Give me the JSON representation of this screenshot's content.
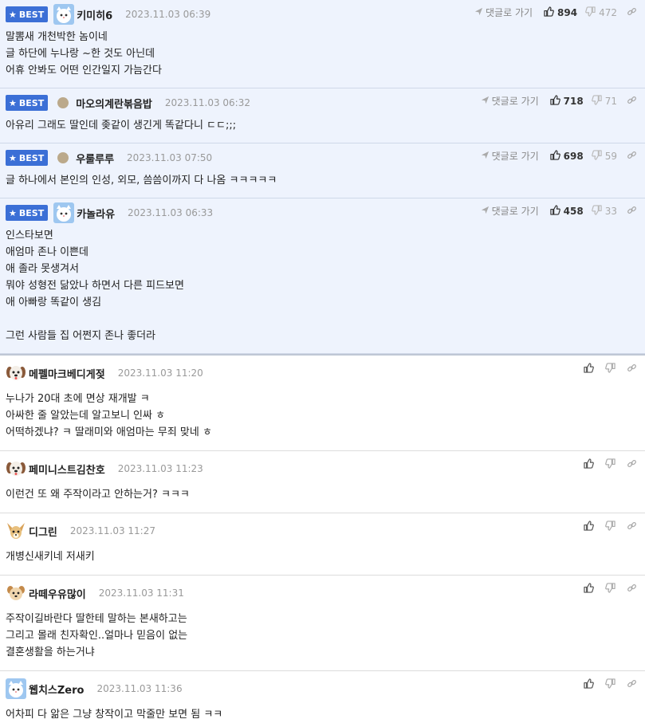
{
  "best_comments": [
    {
      "badge": "BEST",
      "avatar_icon": "white-cat-avatar-icon",
      "nick": "키미히6",
      "date": "2023.11.03 06:39",
      "goto": "댓글로 가기",
      "likes": "894",
      "dislikes": "472",
      "lines": [
        "말뽐새 개천박한 놈이네",
        "글 하단에 누나랑 ~한 것도 아닌데",
        "어휴 안봐도 어떤 인간일지 가늠간다"
      ]
    },
    {
      "badge": "BEST",
      "avatar_icon": "dot-avatar-icon",
      "nick": "마오의계란볶음밥",
      "date": "2023.11.03 06:32",
      "goto": "댓글로 가기",
      "likes": "718",
      "dislikes": "71",
      "lines": [
        "아유리 그래도 딸인데 좆같이 생긴게 똑같다니 ㄷㄷ;;;"
      ]
    },
    {
      "badge": "BEST",
      "avatar_icon": "dot-avatar-icon",
      "nick": "우룰루루",
      "date": "2023.11.03 07:50",
      "goto": "댓글로 가기",
      "likes": "698",
      "dislikes": "59",
      "lines": [
        "글 하나에서 본인의 인성, 외모, 씀씀이까지 다 나옴 ㅋㅋㅋㅋㅋ"
      ]
    },
    {
      "badge": "BEST",
      "avatar_icon": "white-cat-avatar-icon",
      "nick": "카놀라유",
      "date": "2023.11.03 06:33",
      "goto": "댓글로 가기",
      "likes": "458",
      "dislikes": "33",
      "lines": [
        "인스타보면",
        "애엄마 존나 이쁜데",
        "애 졸라 못생겨서",
        "뭐야 성형전 닮았나 하면서 다른 피드보면",
        "애 아빠랑 똑같이 생김",
        "",
        "그런 사람들 집 어쩐지 존나 좋더라"
      ]
    }
  ],
  "comments": [
    {
      "avatar_icon": "puppy-avatar-icon",
      "nick": "메펠마크베디게젖",
      "date": "2023.11.03 11:20",
      "lines": [
        "누나가 20대 초에 면상 재개발 ㅋ",
        "아싸한 줄 알았는데 알고보니 인싸 ㅎ",
        "어떡하겠냐? ㅋ 딸래미와 애엄마는 무죄 맞네 ㅎ"
      ]
    },
    {
      "avatar_icon": "puppy-avatar-icon",
      "nick": "페미니스트김찬호",
      "date": "2023.11.03 11:23",
      "lines": [
        "이런건 또 왜 주작이라고 안하는거? ㅋㅋㅋ"
      ]
    },
    {
      "avatar_icon": "chihuahua-avatar-icon",
      "nick": "디그린",
      "date": "2023.11.03 11:27",
      "lines": [
        "개병신새키네 저새키"
      ]
    },
    {
      "avatar_icon": "dog-face-avatar-icon",
      "nick": "라떼우유많이",
      "date": "2023.11.03 11:31",
      "lines": [
        "주작이길바란다 딸한테 말하는 본새하고는",
        "그리고 몰래 친자확인..얼마나 믿음이 없는",
        "결혼생활을 하는거냐"
      ]
    },
    {
      "avatar_icon": "white-cat-avatar-icon",
      "nick": "웹치스Zero",
      "date": "2023.11.03 11:36",
      "lines": [
        "어차피 다 앎은 그냥 창작이고 막줄만 보면 됨 ㅋㅋ"
      ]
    }
  ],
  "icons": {
    "thumb_up": "thumb-up-icon",
    "thumb_down": "thumb-down-icon",
    "link": "link-icon",
    "send": "send-arrow-icon",
    "star": "star-icon"
  },
  "colors": {
    "best_bg": "#eef3fd",
    "badge": "#3b6fd6"
  }
}
